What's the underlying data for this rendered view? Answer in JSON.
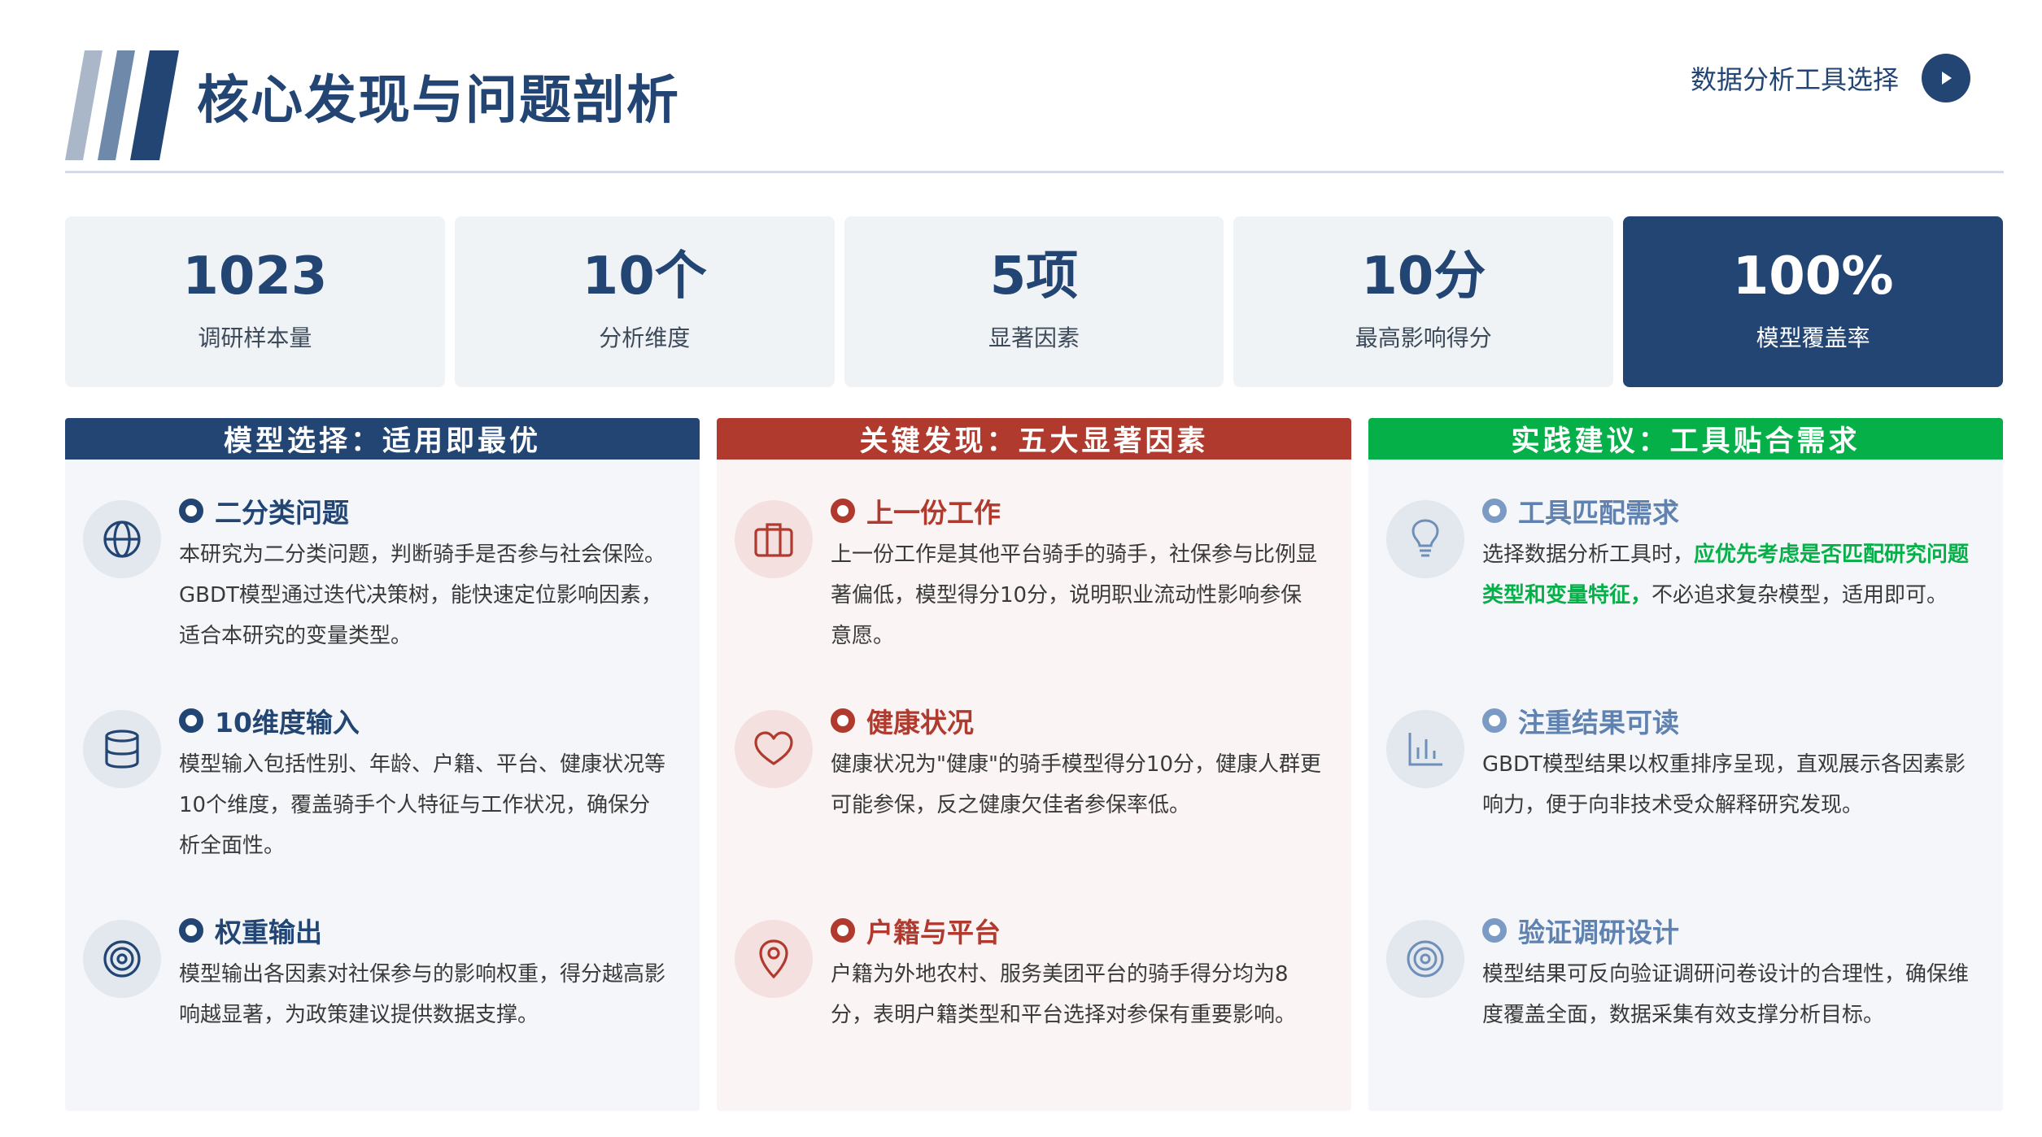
{
  "header": {
    "title": "核心发现与问题剖析",
    "nav_label": "数据分析工具选择",
    "accent": "#224574"
  },
  "stats": [
    {
      "value": "1023",
      "label": "调研样本量"
    },
    {
      "value": "10个",
      "label": "分析维度"
    },
    {
      "value": "5项",
      "label": "显著因素"
    },
    {
      "value": "10分",
      "label": "最高影响得分"
    },
    {
      "value": "100%",
      "label": "模型覆盖率"
    }
  ],
  "columns": [
    {
      "heading": "模型选择：适用即最优",
      "color": "#224574",
      "items": [
        {
          "icon": "globe-icon",
          "title": "二分类问题",
          "text": "本研究为二分类问题，判断骑手是否参与社会保险。GBDT模型通过迭代决策树，能快速定位影响因素，适合本研究的变量类型。"
        },
        {
          "icon": "database-icon",
          "title": "10维度输入",
          "text": "模型输入包括性别、年龄、户籍、平台、健康状况等10个维度，覆盖骑手个人特征与工作状况，确保分析全面性。"
        },
        {
          "icon": "target-icon",
          "title": "权重输出",
          "text": "模型输出各因素对社保参与的影响权重，得分越高影响越显著，为政策建议提供数据支撑。"
        }
      ]
    },
    {
      "heading": "关键发现：五大显著因素",
      "color": "#b03a2e",
      "items": [
        {
          "icon": "briefcase-icon",
          "title": "上一份工作",
          "text": "上一份工作是其他平台骑手的骑手，社保参与比例显著偏低，模型得分10分，说明职业流动性影响参保意愿。"
        },
        {
          "icon": "heart-icon",
          "title": "健康状况",
          "text": "健康状况为\"健康\"的骑手模型得分10分，健康人群更可能参保，反之健康欠佳者参保率低。"
        },
        {
          "icon": "map-pin-icon",
          "title": "户籍与平台",
          "text": "户籍为外地农村、服务美团平台的骑手得分均为8分，表明户籍类型和平台选择对参保有重要影响。"
        }
      ]
    },
    {
      "heading": "实践建议：工具贴合需求",
      "color": "#06b048",
      "items": [
        {
          "icon": "lightbulb-icon",
          "title": "工具匹配需求",
          "text_before": "选择数据分析工具时，",
          "text_highlight": "应优先考虑是否匹配研究问题类型和变量特征，",
          "text_after": "不必追求复杂模型，适用即可。"
        },
        {
          "icon": "bar-chart-icon",
          "title": "注重结果可读",
          "text": "GBDT模型结果以权重排序呈现，直观展示各因素影响力，便于向非技术受众解释研究发现。"
        },
        {
          "icon": "target-icon",
          "title": "验证调研设计",
          "text": "模型结果可反向验证调研问卷设计的合理性，确保维度覆盖全面，数据采集有效支撑分析目标。"
        }
      ]
    }
  ]
}
